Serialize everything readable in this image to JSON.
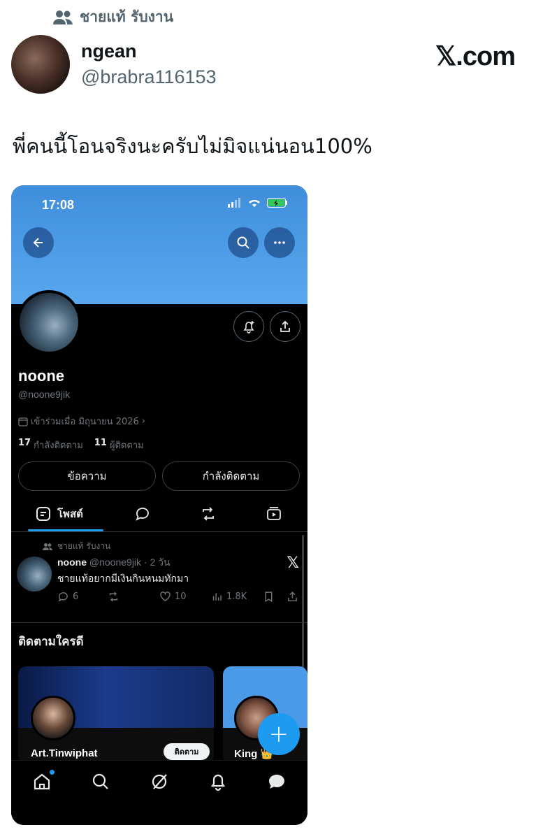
{
  "tweet": {
    "community": "ชายแท้ รับงาน",
    "author_name": "ngean",
    "author_handle": "@brabra116153",
    "source": "𝕏.com",
    "text": "พี่คนนี้โอนจริงนะครับไม่มิจแน่นอน100%"
  },
  "phone": {
    "status_time": "17:08",
    "profile": {
      "name": "noone",
      "handle": "@noone9jik",
      "joined": "เข้าร่วมเมื่อ มิถุนายน 2026",
      "following_count": "17",
      "following_label": "กำลังติดตาม",
      "followers_count": "11",
      "followers_label": "ผู้ติดตาม"
    },
    "buttons": {
      "message": "ข้อความ",
      "following": "กำลังติดตาม"
    },
    "tabs": {
      "posts": "โพสต์"
    },
    "post": {
      "community": "ชายแท้ รับงาน",
      "name": "noone",
      "handle_time": "@noone9jik · 2 วัน",
      "x_mark": "𝕏",
      "text": "ชายแท้อยากมีเงินกินหนมทักมา",
      "replies": "6",
      "likes": "10",
      "views": "1.8K"
    },
    "who_to_follow": {
      "title": "ติดตามใครดี",
      "cards": [
        {
          "name": "Art.Tinwiphat",
          "button": "ติดตาม"
        },
        {
          "name": "King 👑"
        }
      ]
    },
    "fab": "+"
  },
  "colors": {
    "accent": "#1d9bf0",
    "banner": "#4a9ae8",
    "dark_bg": "#000000",
    "muted": "#71767b"
  }
}
